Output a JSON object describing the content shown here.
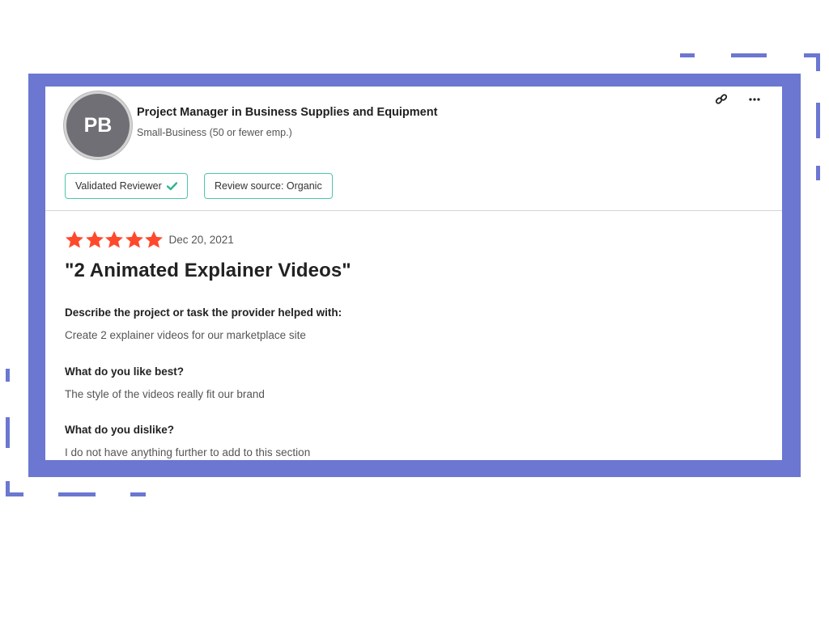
{
  "reviewer": {
    "initials": "PB",
    "title": "Project Manager in Business Supplies and Equipment",
    "company_size": "Small-Business (50 or fewer emp.)",
    "badges": [
      {
        "label": "Validated Reviewer",
        "icon": "check-icon"
      },
      {
        "label": "Review source: Organic"
      }
    ]
  },
  "actions": {
    "link_icon": "link-icon",
    "more_icon": "more-icon"
  },
  "review": {
    "rating": 5,
    "max_rating": 5,
    "date": "Dec 20, 2021",
    "title": "\"2 Animated Explainer Videos\"",
    "qa": [
      {
        "question": "Describe the project or task the provider helped with:",
        "answer": "Create 2 explainer videos for our marketplace site"
      },
      {
        "question": "What do you like best?",
        "answer": "The style of the videos really fit our brand"
      },
      {
        "question": "What do you dislike?",
        "answer": "I do not have anything further to add to this section"
      }
    ]
  },
  "colors": {
    "frame": "#6b77d1",
    "star": "#ff492c",
    "badge_border": "#4cc7a9",
    "avatar": "#6f6f75"
  }
}
